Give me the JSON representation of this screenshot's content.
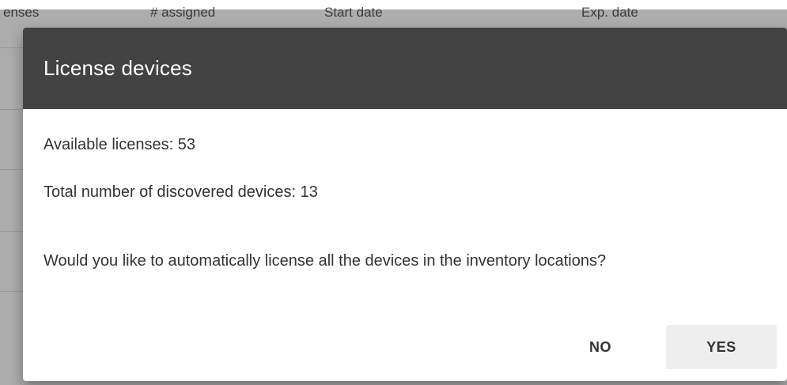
{
  "table": {
    "headers": [
      "enses",
      "# assigned",
      "Start date",
      "Exp. date"
    ]
  },
  "dialog": {
    "title": "License devices",
    "available_licenses": "Available licenses: 53",
    "total_devices": "Total number of discovered devices: 13",
    "question": "Would you like to automatically license all the devices in the inventory locations?",
    "no_label": "NO",
    "yes_label": "YES"
  }
}
